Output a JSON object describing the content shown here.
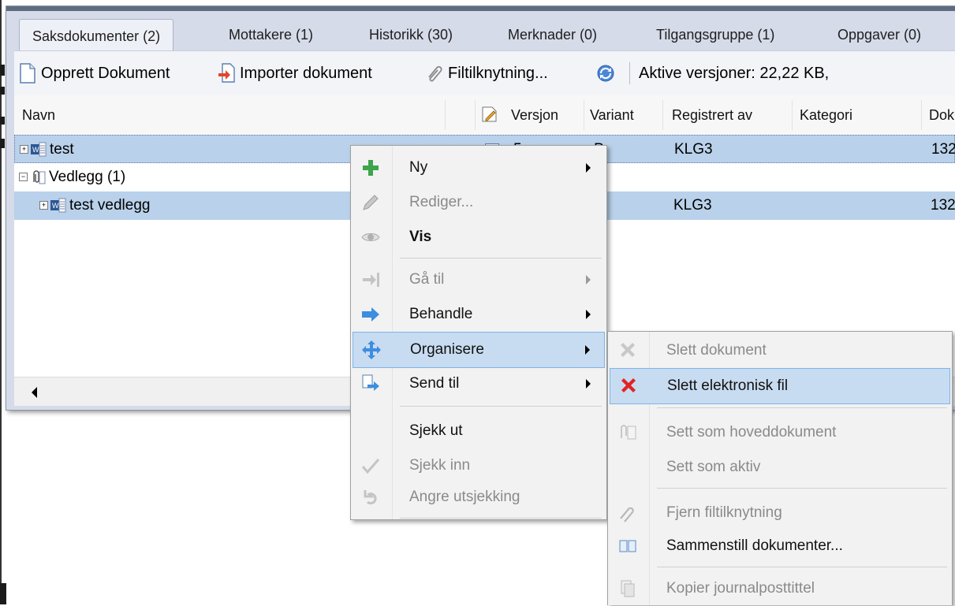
{
  "tabs": [
    {
      "label": "Saksdokumenter (2)"
    },
    {
      "label": "Mottakere (1)"
    },
    {
      "label": "Historikk (30)"
    },
    {
      "label": "Merknader (0)"
    },
    {
      "label": "Tilgangsgruppe (1)"
    },
    {
      "label": "Oppgaver (0)"
    }
  ],
  "toolbar": {
    "create": "Opprett Dokument",
    "import": "Importer dokument",
    "link": "Filtilknytning...",
    "status": "Aktive versjoner: 22,22 KB,"
  },
  "grid": {
    "columns": [
      "Navn",
      "Versjon",
      "Variant",
      "Registrert av",
      "Kategori",
      "Dok"
    ],
    "rows": [
      {
        "name": "test",
        "version": "5",
        "variant": "P",
        "registered_by": "KLG3",
        "dok": "132"
      },
      {
        "name": "Vedlegg (1)",
        "version": "",
        "variant": "",
        "registered_by": "",
        "dok": ""
      },
      {
        "name": "test vedlegg",
        "version": "",
        "variant": "",
        "registered_by": "KLG3",
        "dok": "132"
      }
    ]
  },
  "context_menu": {
    "items": [
      {
        "label": "Ny",
        "icon": "plus-icon"
      },
      {
        "label": "Rediger...",
        "icon": "pencil-icon"
      },
      {
        "label": "Vis",
        "icon": "eye-icon"
      },
      {
        "label": "Gå til",
        "icon": "goto-arrow-icon"
      },
      {
        "label": "Behandle",
        "icon": "process-arrow-icon"
      },
      {
        "label": "Organisere",
        "icon": "move-icon"
      },
      {
        "label": "Send til",
        "icon": "send-icon"
      },
      {
        "label": "Sjekk ut",
        "icon": ""
      },
      {
        "label": "Sjekk inn",
        "icon": "checkmark-icon"
      },
      {
        "label": "Angre utsjekking",
        "icon": "undo-icon"
      }
    ]
  },
  "submenu": {
    "items": [
      {
        "label": "Slett dokument",
        "icon": "delete-icon"
      },
      {
        "label": "Slett elektronisk fil",
        "icon": "delete-file-icon"
      },
      {
        "label": "Sett som hoveddokument",
        "icon": "main-document-icon"
      },
      {
        "label": "Sett som aktiv",
        "icon": ""
      },
      {
        "label": "Fjern filtilknytning",
        "icon": "unlink-icon"
      },
      {
        "label": "Sammenstill dokumenter...",
        "icon": "merge-icon"
      },
      {
        "label": "Kopier journalposttittel",
        "icon": "copy-icon"
      }
    ]
  },
  "colors": {
    "selection": "#b9d1ea",
    "menu_highlight": "#c8dcf1",
    "menu_highlight_border": "#7eb4ea"
  }
}
